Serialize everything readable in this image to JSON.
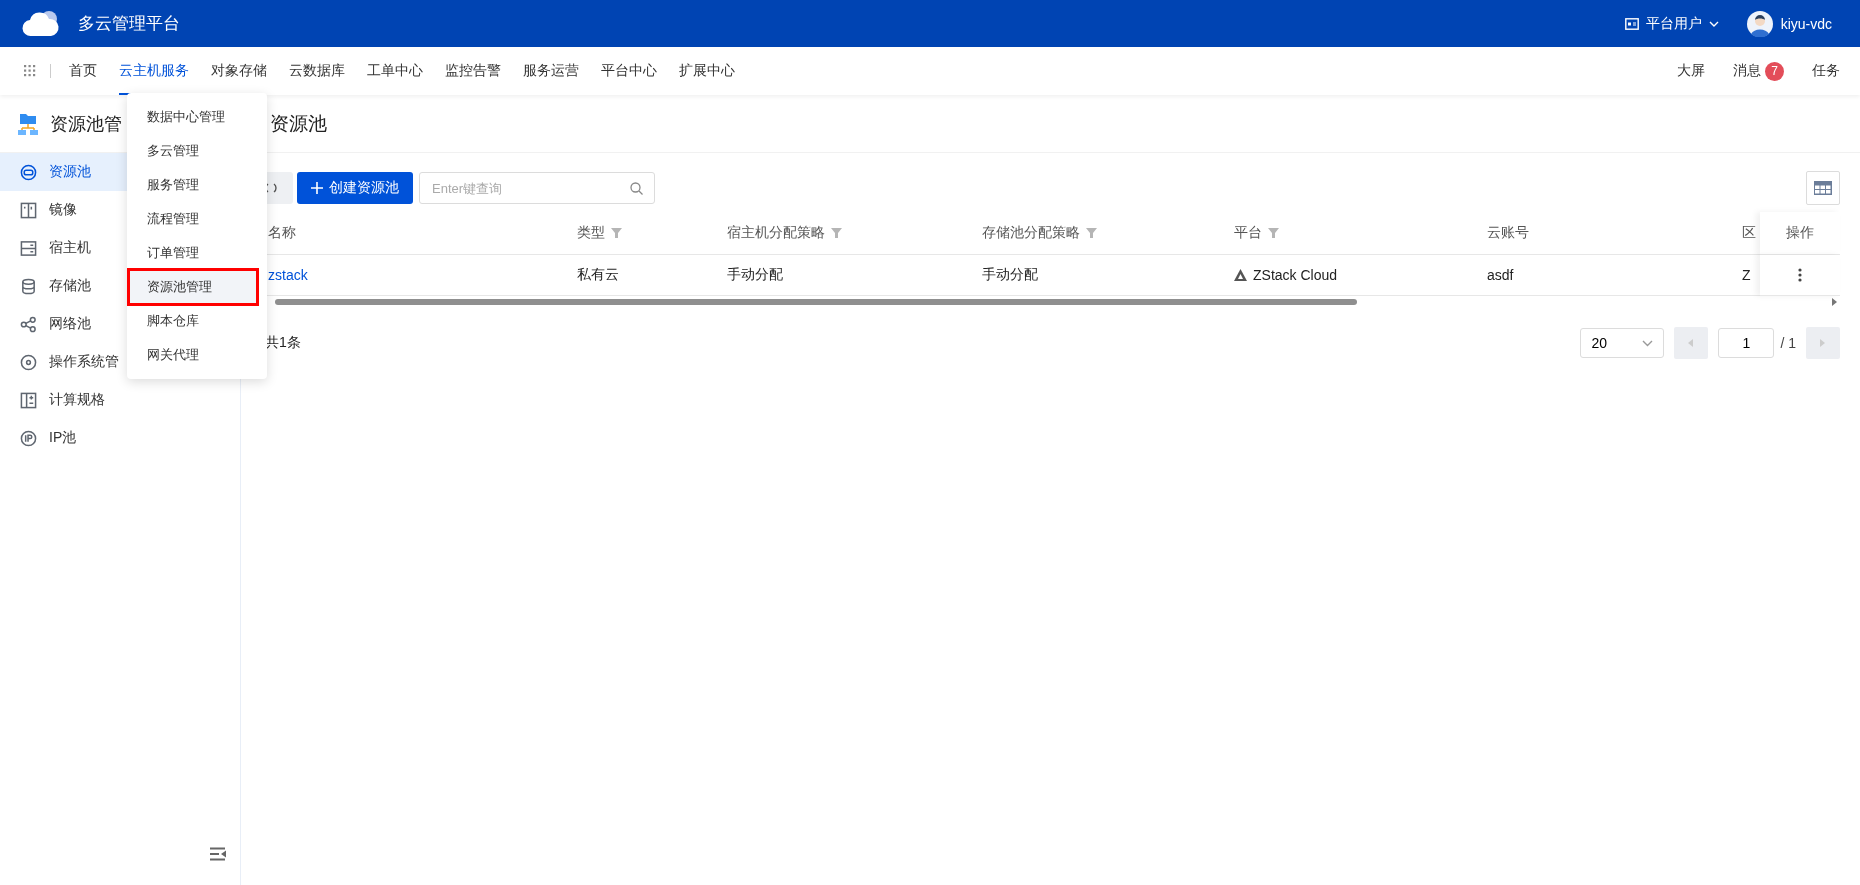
{
  "header": {
    "title": "多云管理平台",
    "role_menu": "平台用户",
    "username": "kiyu-vdc"
  },
  "nav": {
    "items": [
      {
        "label": "首页",
        "selected": false
      },
      {
        "label": "云主机服务",
        "selected": true
      },
      {
        "label": "对象存储",
        "selected": false
      },
      {
        "label": "云数据库",
        "selected": false
      },
      {
        "label": "工单中心",
        "selected": false
      },
      {
        "label": "监控告警",
        "selected": false
      },
      {
        "label": "服务运营",
        "selected": false
      },
      {
        "label": "平台中心",
        "selected": false
      },
      {
        "label": "扩展中心",
        "selected": false
      }
    ],
    "right": [
      {
        "label": "大屏"
      },
      {
        "label": "消息",
        "badge": "7"
      },
      {
        "label": "任务"
      }
    ]
  },
  "sidebar": {
    "title": "资源池管",
    "items": [
      {
        "label": "资源池",
        "kind": "pool",
        "selected": true
      },
      {
        "label": "镜像",
        "kind": "image",
        "selected": false
      },
      {
        "label": "宿主机",
        "kind": "host",
        "selected": false
      },
      {
        "label": "存储池",
        "kind": "storage",
        "selected": false
      },
      {
        "label": "网络池",
        "kind": "network",
        "selected": false
      },
      {
        "label": "操作系统管",
        "kind": "os",
        "selected": false
      },
      {
        "label": "计算规格",
        "kind": "spec",
        "selected": false
      },
      {
        "label": "IP池",
        "kind": "ip",
        "selected": false
      }
    ]
  },
  "dropdown": {
    "items": [
      {
        "label": "数据中心管理",
        "selected": false,
        "highlighted": false
      },
      {
        "label": "多云管理",
        "selected": false,
        "highlighted": false
      },
      {
        "label": "服务管理",
        "selected": false,
        "highlighted": false
      },
      {
        "label": "流程管理",
        "selected": false,
        "highlighted": false
      },
      {
        "label": "订单管理",
        "selected": false,
        "highlighted": false
      },
      {
        "label": "资源池管理",
        "selected": true,
        "highlighted": true
      },
      {
        "label": "脚本仓库",
        "selected": false,
        "highlighted": false
      },
      {
        "label": "网关代理",
        "selected": false,
        "highlighted": false
      }
    ]
  },
  "page": {
    "title": "资源池",
    "create_button": "创建资源池",
    "search": {
      "placeholder": "Enter键查询"
    }
  },
  "table": {
    "columns": [
      {
        "label": "名称",
        "filter": false,
        "kind": "link"
      },
      {
        "label": "类型",
        "filter": true,
        "kind": "text"
      },
      {
        "label": "宿主机分配策略",
        "filter": true,
        "kind": "text"
      },
      {
        "label": "存储池分配策略",
        "filter": true,
        "kind": "text"
      },
      {
        "label": "平台",
        "filter": true,
        "kind": "platform"
      },
      {
        "label": "云账号",
        "filter": false,
        "kind": "text"
      },
      {
        "label": "区",
        "kind": "text"
      }
    ],
    "actions_column": "操作",
    "rows": [
      {
        "cells": [
          "zstack",
          "私有云",
          "手动分配",
          "手动分配",
          "ZStack Cloud",
          "asdf",
          "Z"
        ]
      }
    ]
  },
  "pagination": {
    "total": "共1条",
    "page_size": "20",
    "page": "1",
    "total_pages": "/ 1"
  }
}
